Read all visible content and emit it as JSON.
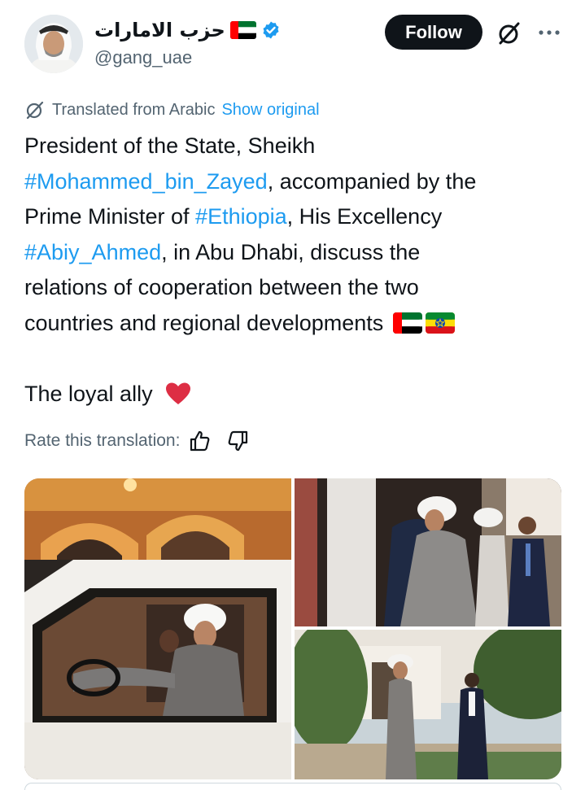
{
  "author": {
    "display_name": "حزب الامارات",
    "handle": "@gang_uae",
    "flag_icon": "uae-flag-icon",
    "verified_icon": "verified-badge-icon",
    "verified_color": "#1d9bf0"
  },
  "actions": {
    "follow_label": "Follow",
    "grok_icon": "grok-icon",
    "more_icon": "more-icon"
  },
  "translation": {
    "label": "Translated from Arabic",
    "show_original": "Show original",
    "rate_label": "Rate this translation:"
  },
  "tweet": {
    "line1": "President of the State, Sheikh",
    "tag_mbz": "#Mohammed_bin_Zayed",
    "line2_rest": ", accompanied by the",
    "line3_start": "Prime Minister of ",
    "tag_ethiopia": "#Ethiopia",
    "line3_rest": ", His Excellency",
    "tag_abiy": "#Abiy_Ahmed",
    "line4_rest": ", in Abu Dhabi, discuss the",
    "line5": "relations of cooperation between the two",
    "line6": "countries and regional developments",
    "line7": "The loyal ally"
  },
  "colors": {
    "text": "#0f1419",
    "secondary": "#536471",
    "link": "#1d9bf0",
    "heart": "#e0245e"
  }
}
